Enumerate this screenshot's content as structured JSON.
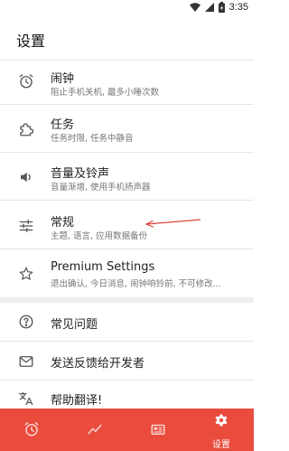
{
  "status_bar": {
    "time": "3:35",
    "icons": [
      "wifi-icon",
      "signal-icon",
      "battery-icon"
    ]
  },
  "header": {
    "title": "设置"
  },
  "settings": [
    {
      "icon": "alarm-clock-icon",
      "title": "闹钟",
      "subtitle": "阻止手机关机, 最多小睡次数"
    },
    {
      "icon": "puzzle-icon",
      "title": "任务",
      "subtitle": "任务时限, 任务中静音"
    },
    {
      "icon": "volume-icon",
      "title": "音量及铃声",
      "subtitle": "音量渐增, 使用手机扬声器"
    },
    {
      "icon": "sliders-icon",
      "title": "常规",
      "subtitle": "主题, 语言, 应用数据备份"
    },
    {
      "icon": "star-icon",
      "title": "Premium Settings",
      "subtitle": "退出确认, 今日消息, 闹钟响铃前, 不可修改..."
    }
  ],
  "support": [
    {
      "icon": "help-icon",
      "title": "常见问题"
    },
    {
      "icon": "mail-icon",
      "title": "发送反馈给开发者"
    },
    {
      "icon": "translate-icon",
      "title": "帮助翻译!"
    }
  ],
  "bottom_nav": {
    "items": [
      {
        "icon": "alarm-nav-icon",
        "label": ""
      },
      {
        "icon": "chart-nav-icon",
        "label": ""
      },
      {
        "icon": "news-nav-icon",
        "label": ""
      },
      {
        "icon": "settings-gear-icon",
        "label": "设置"
      }
    ],
    "active_index": 3
  },
  "colors": {
    "accent": "#e94c3d",
    "text_primary": "#222222",
    "text_secondary": "#757575",
    "divider": "#e5e5e5"
  }
}
